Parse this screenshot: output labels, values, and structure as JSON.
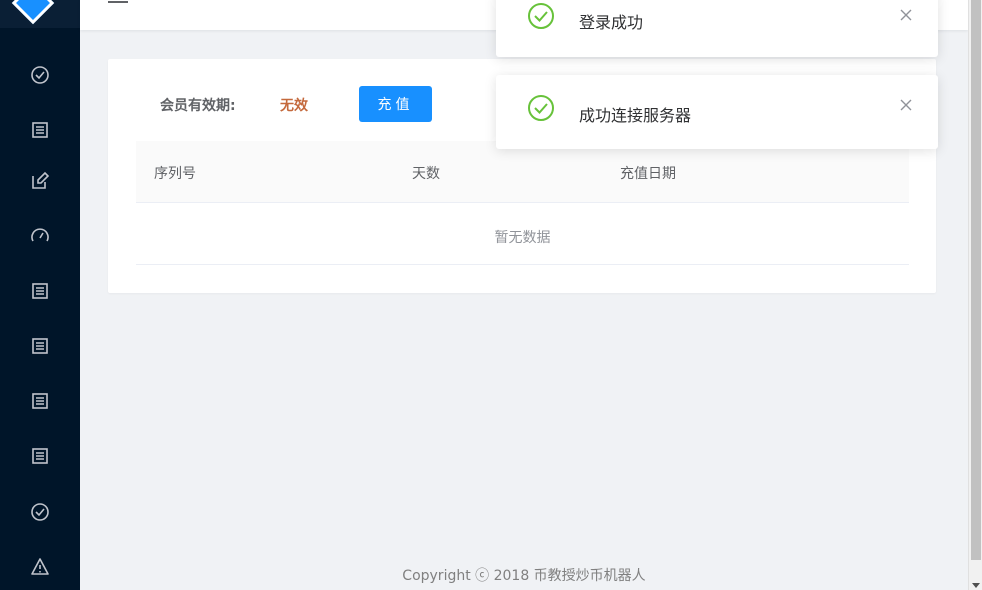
{
  "sidebar": {
    "items": [
      {
        "icon": "check-circle-icon"
      },
      {
        "icon": "list-icon"
      },
      {
        "icon": "edit-icon"
      },
      {
        "icon": "dashboard-icon"
      },
      {
        "icon": "list-icon"
      },
      {
        "icon": "list-icon"
      },
      {
        "icon": "list-icon"
      },
      {
        "icon": "list-icon"
      },
      {
        "icon": "check-circle-icon"
      },
      {
        "icon": "warning-icon"
      }
    ]
  },
  "member": {
    "label": "会员有效期:",
    "value": "无效",
    "recharge_label": "充值"
  },
  "table": {
    "columns": [
      "序列号",
      "天数",
      "充值日期"
    ],
    "empty_text": "暂无数据"
  },
  "footer": {
    "text": "Copyright ⓒ 2018 币教授炒币机器人"
  },
  "notifications": [
    {
      "message": "登录成功",
      "icon": "success-check-icon"
    },
    {
      "message": "成功连接服务器",
      "icon": "success-check-icon"
    }
  ],
  "colors": {
    "sidebar_bg": "#001529",
    "primary": "#1890ff",
    "invalid": "#c4693c",
    "success": "#67c23a"
  }
}
